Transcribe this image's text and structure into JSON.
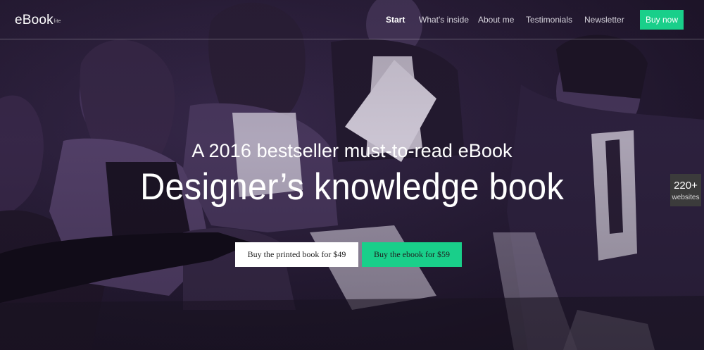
{
  "brand": {
    "name": "eBook",
    "superscript": "lite"
  },
  "nav": {
    "items": [
      {
        "label": "Start",
        "active": true
      },
      {
        "label": "What's inside",
        "active": false
      },
      {
        "label": "About me",
        "active": false
      },
      {
        "label": "Testimonials",
        "active": false
      },
      {
        "label": "Newsletter",
        "active": false
      }
    ],
    "cta_label": "Buy now"
  },
  "hero": {
    "subtitle": "A 2016 bestseller must-to-read eBook",
    "title": "Designer’s knowledge book",
    "buttons": {
      "printed_label": "Buy the printed book for $49",
      "ebook_label": "Buy the ebook for $59"
    }
  },
  "side_badge": {
    "count": "220+",
    "label": "websites"
  },
  "colors": {
    "accent": "#19cf8a",
    "overlay": "#2a1d3a",
    "badge_bg": "#3b3b3b"
  },
  "icons": {
    "background": "photo-of-people-reading"
  }
}
